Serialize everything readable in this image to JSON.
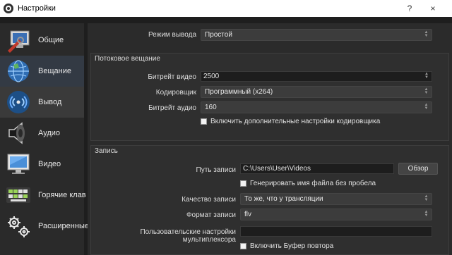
{
  "window": {
    "title": "Настройки",
    "help": "?",
    "close": "×"
  },
  "sidebar": {
    "items": [
      {
        "label": "Общие",
        "icon": "monitor-wrench-icon"
      },
      {
        "label": "Вещание",
        "icon": "globe-icon"
      },
      {
        "label": "Вывод",
        "icon": "broadcast-icon"
      },
      {
        "label": "Аудио",
        "icon": "speaker-icon"
      },
      {
        "label": "Видео",
        "icon": "display-icon"
      },
      {
        "label": "Горячие клав",
        "icon": "keyboard-icon"
      },
      {
        "label": "Расширенные",
        "icon": "gears-icon"
      }
    ]
  },
  "output_mode": {
    "label": "Режим вывода",
    "value": "Простой"
  },
  "streaming": {
    "title": "Потоковое вещание",
    "video_bitrate_label": "Битрейт видео",
    "video_bitrate_value": "2500",
    "encoder_label": "Кодировщик",
    "encoder_value": "Программный (x264)",
    "audio_bitrate_label": "Битрейт аудио",
    "audio_bitrate_value": "160",
    "advanced_check_label": "Включить дополнительные настройки кодировщика"
  },
  "recording": {
    "title": "Запись",
    "path_label": "Путь записи",
    "path_value": "C:\\Users\\User\\Videos",
    "browse_label": "Обзор",
    "nospace_check_label": "Генерировать имя файла без пробела",
    "quality_label": "Качество записи",
    "quality_value": "То же, что у трансляции",
    "format_label": "Формат записи",
    "format_value": "flv",
    "muxer_label": "Пользовательские настройки мультиплексора",
    "muxer_value": "",
    "replay_check_label": "Включить Буфер повтора"
  }
}
